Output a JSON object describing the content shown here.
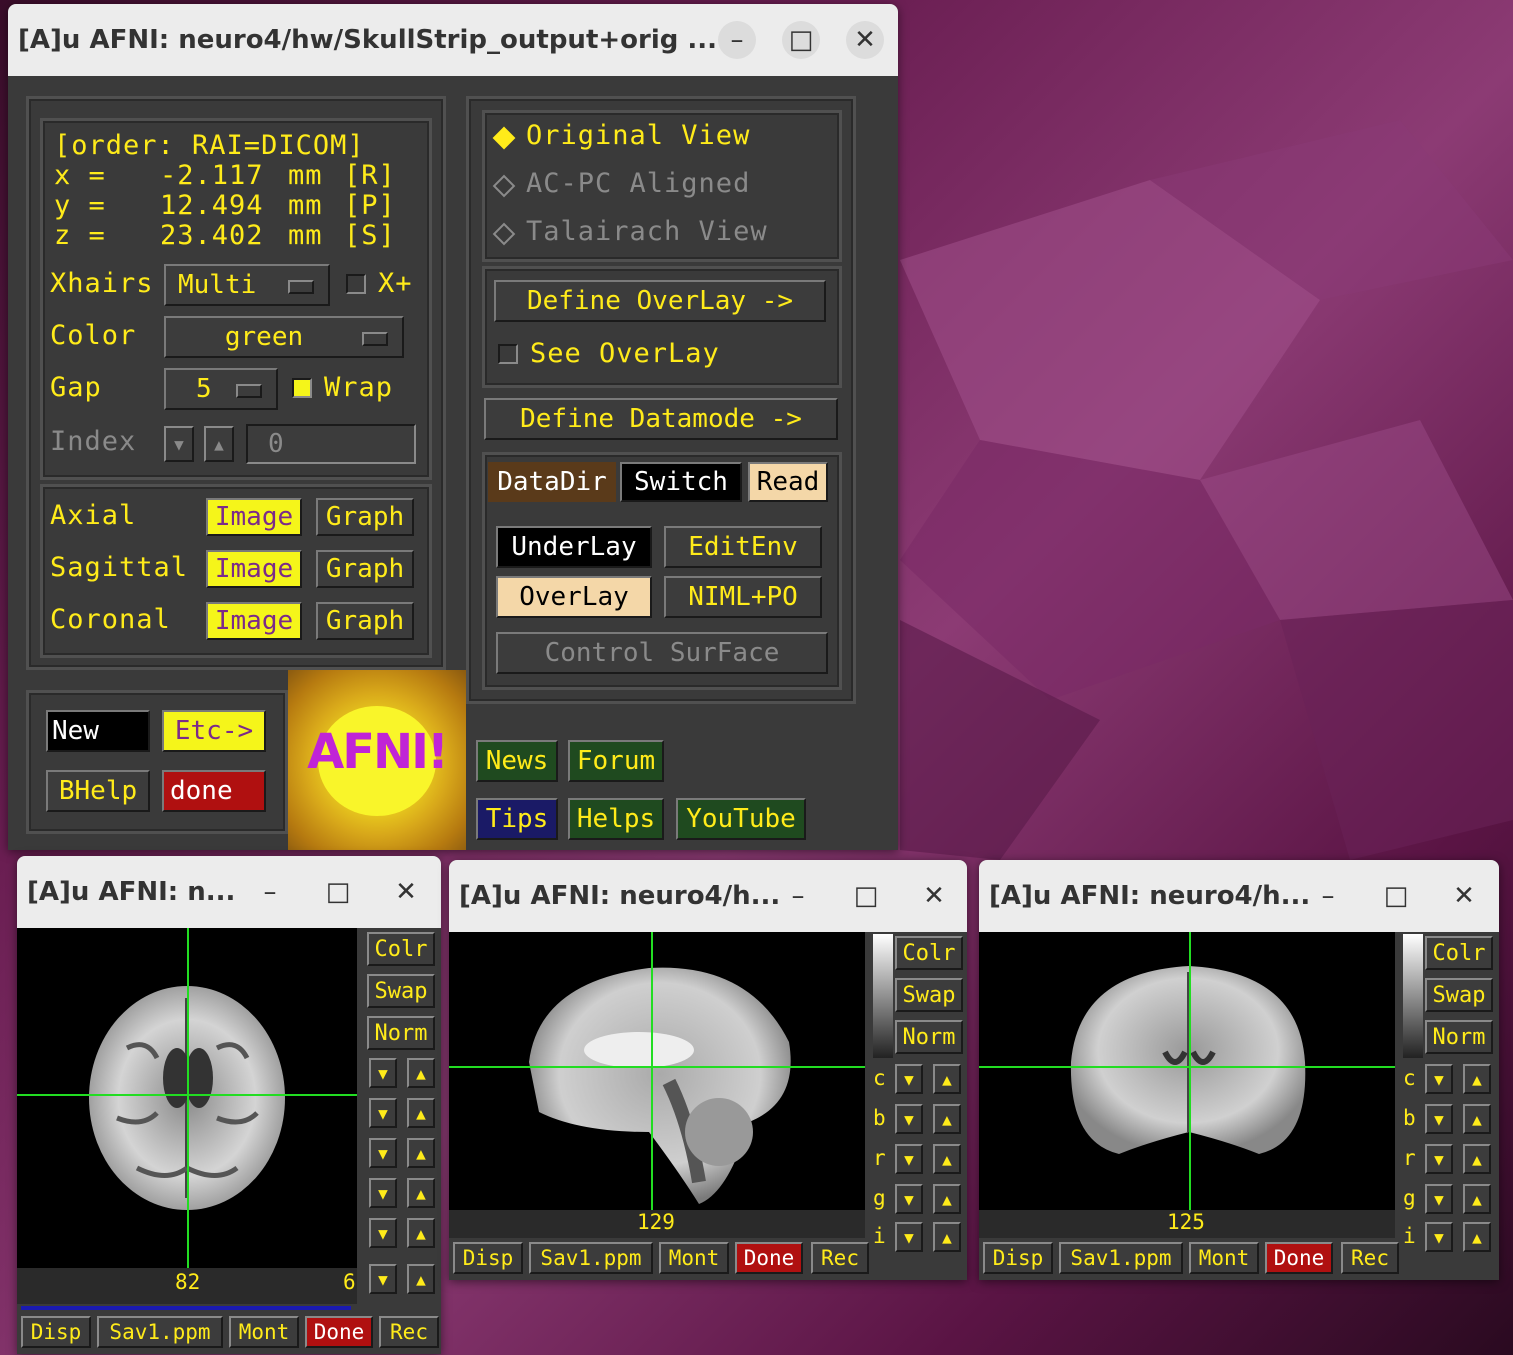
{
  "main_window": {
    "title": "[A]u AFNI: neuro4/hw/SkullStrip_output+orig ...",
    "order_line": "[order: RAI=DICOM]",
    "coords": [
      {
        "axis": "x =",
        "value": "-2.117",
        "unit": "mm",
        "dir": "[R]"
      },
      {
        "axis": "y =",
        "value": "12.494",
        "unit": "mm",
        "dir": "[P]"
      },
      {
        "axis": "z =",
        "value": "23.402",
        "unit": "mm",
        "dir": "[S]"
      }
    ],
    "xhairs_label": "Xhairs",
    "xhairs_value": "Multi",
    "xplus_label": "X+",
    "color_label": "Color",
    "color_value": "green",
    "gap_label": "Gap",
    "gap_value": "5",
    "wrap_label": "Wrap",
    "index_label": "Index",
    "index_value": "0",
    "views": [
      {
        "label": "Axial",
        "image": "Image",
        "graph": "Graph"
      },
      {
        "label": "Sagittal",
        "image": "Image",
        "graph": "Graph"
      },
      {
        "label": "Coronal",
        "image": "Image",
        "graph": "Graph"
      }
    ],
    "new_label": "New",
    "etc_label": "Etc->",
    "bhelp_label": "BHelp",
    "done_label": "done",
    "logo_text": "AFNI!",
    "view_options": [
      "Original View",
      "AC-PC Aligned",
      "Talairach View"
    ],
    "define_overlay": "Define OverLay ->",
    "see_overlay": "See OverLay",
    "define_datamode": "Define Datamode ->",
    "datadir": "DataDir",
    "switch": "Switch",
    "read": "Read",
    "underlay": "UnderLay",
    "editenv": "EditEnv",
    "overlay": "OverLay",
    "niml": "NIML+PO",
    "control_surface": "Control SurFace",
    "news": "News",
    "forum": "Forum",
    "tips": "Tips",
    "helps": "Helps",
    "youtube": "YouTube"
  },
  "image_windows": [
    {
      "title": "[A]u AFNI: n...",
      "slice": "82",
      "extra": "6"
    },
    {
      "title": "[A]u AFNI: neuro4/h...",
      "slice": "129"
    },
    {
      "title": "[A]u AFNI: neuro4/h...",
      "slice": "125"
    }
  ],
  "side_buttons": {
    "colr": "Colr",
    "swap": "Swap",
    "norm": "Norm"
  },
  "bottom_buttons": {
    "disp": "Disp",
    "sav": "Sav1.ppm",
    "mont": "Mont",
    "done": "Done",
    "rec": "Rec"
  },
  "slider_letters": [
    "c",
    "b",
    "r",
    "g",
    "i"
  ],
  "controls": {
    "minimize": "–",
    "maximize": "□",
    "close": "✕"
  }
}
